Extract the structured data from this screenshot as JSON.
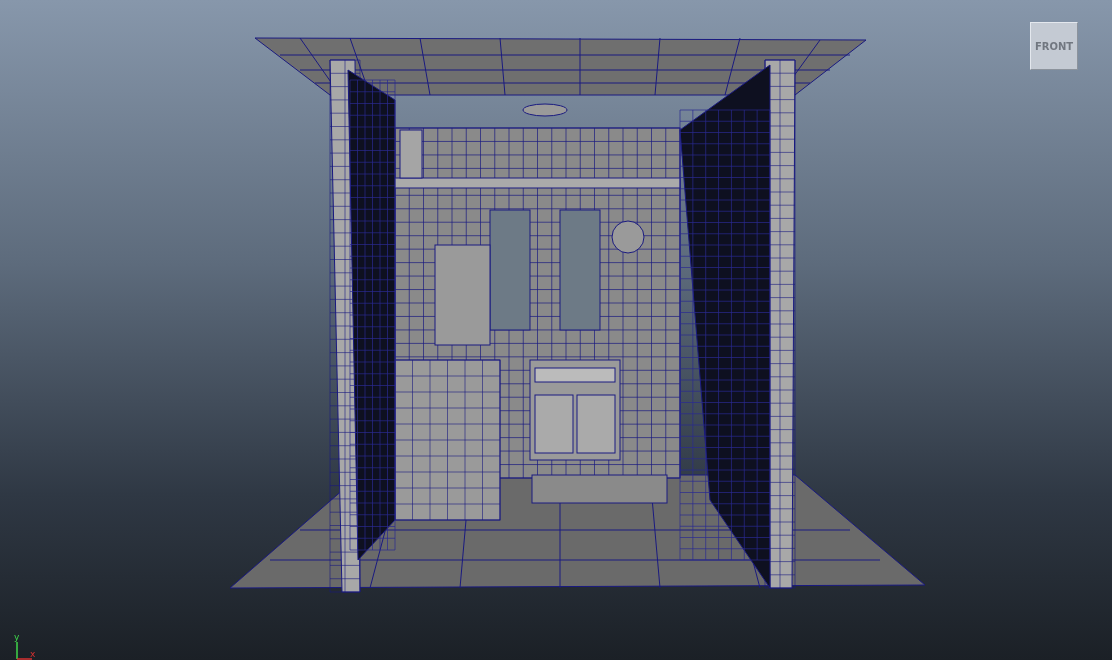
{
  "viewport": {
    "view_cube": {
      "label": "FRONT"
    },
    "axis": {
      "y_label": "y",
      "x_label": "x"
    }
  }
}
